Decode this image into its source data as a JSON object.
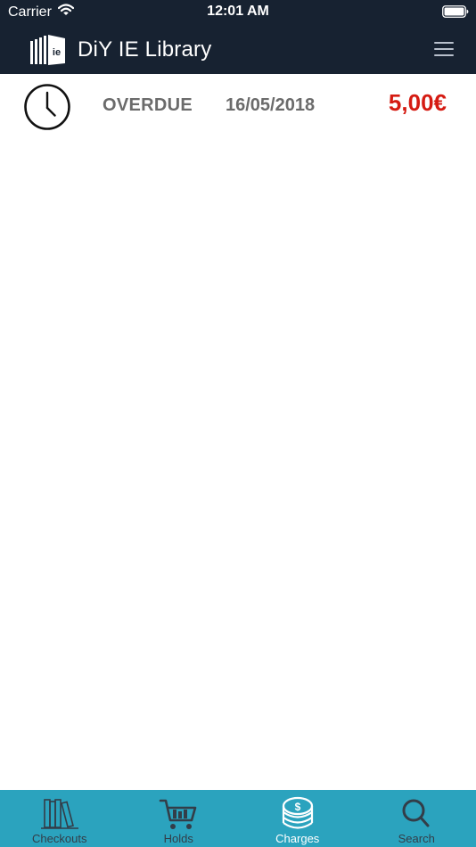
{
  "status_bar": {
    "carrier": "Carrier",
    "time": "12:01 AM"
  },
  "header": {
    "title": "DiY IE Library",
    "logo_text": "ie"
  },
  "charges": [
    {
      "icon": "clock-icon",
      "reason": "OVERDUE",
      "date": "16/05/2018",
      "amount": "5,00€"
    }
  ],
  "tabs": [
    {
      "label": "Checkouts",
      "icon": "books-icon",
      "active": false
    },
    {
      "label": "Holds",
      "icon": "cart-icon",
      "active": false
    },
    {
      "label": "Charges",
      "icon": "coins-icon",
      "active": true
    },
    {
      "label": "Search",
      "icon": "search-icon",
      "active": false
    }
  ],
  "colors": {
    "header_bg": "#172231",
    "tab_bar_bg": "#2ba3be",
    "amount": "#d51b12",
    "row_text": "#6b6b6b"
  }
}
